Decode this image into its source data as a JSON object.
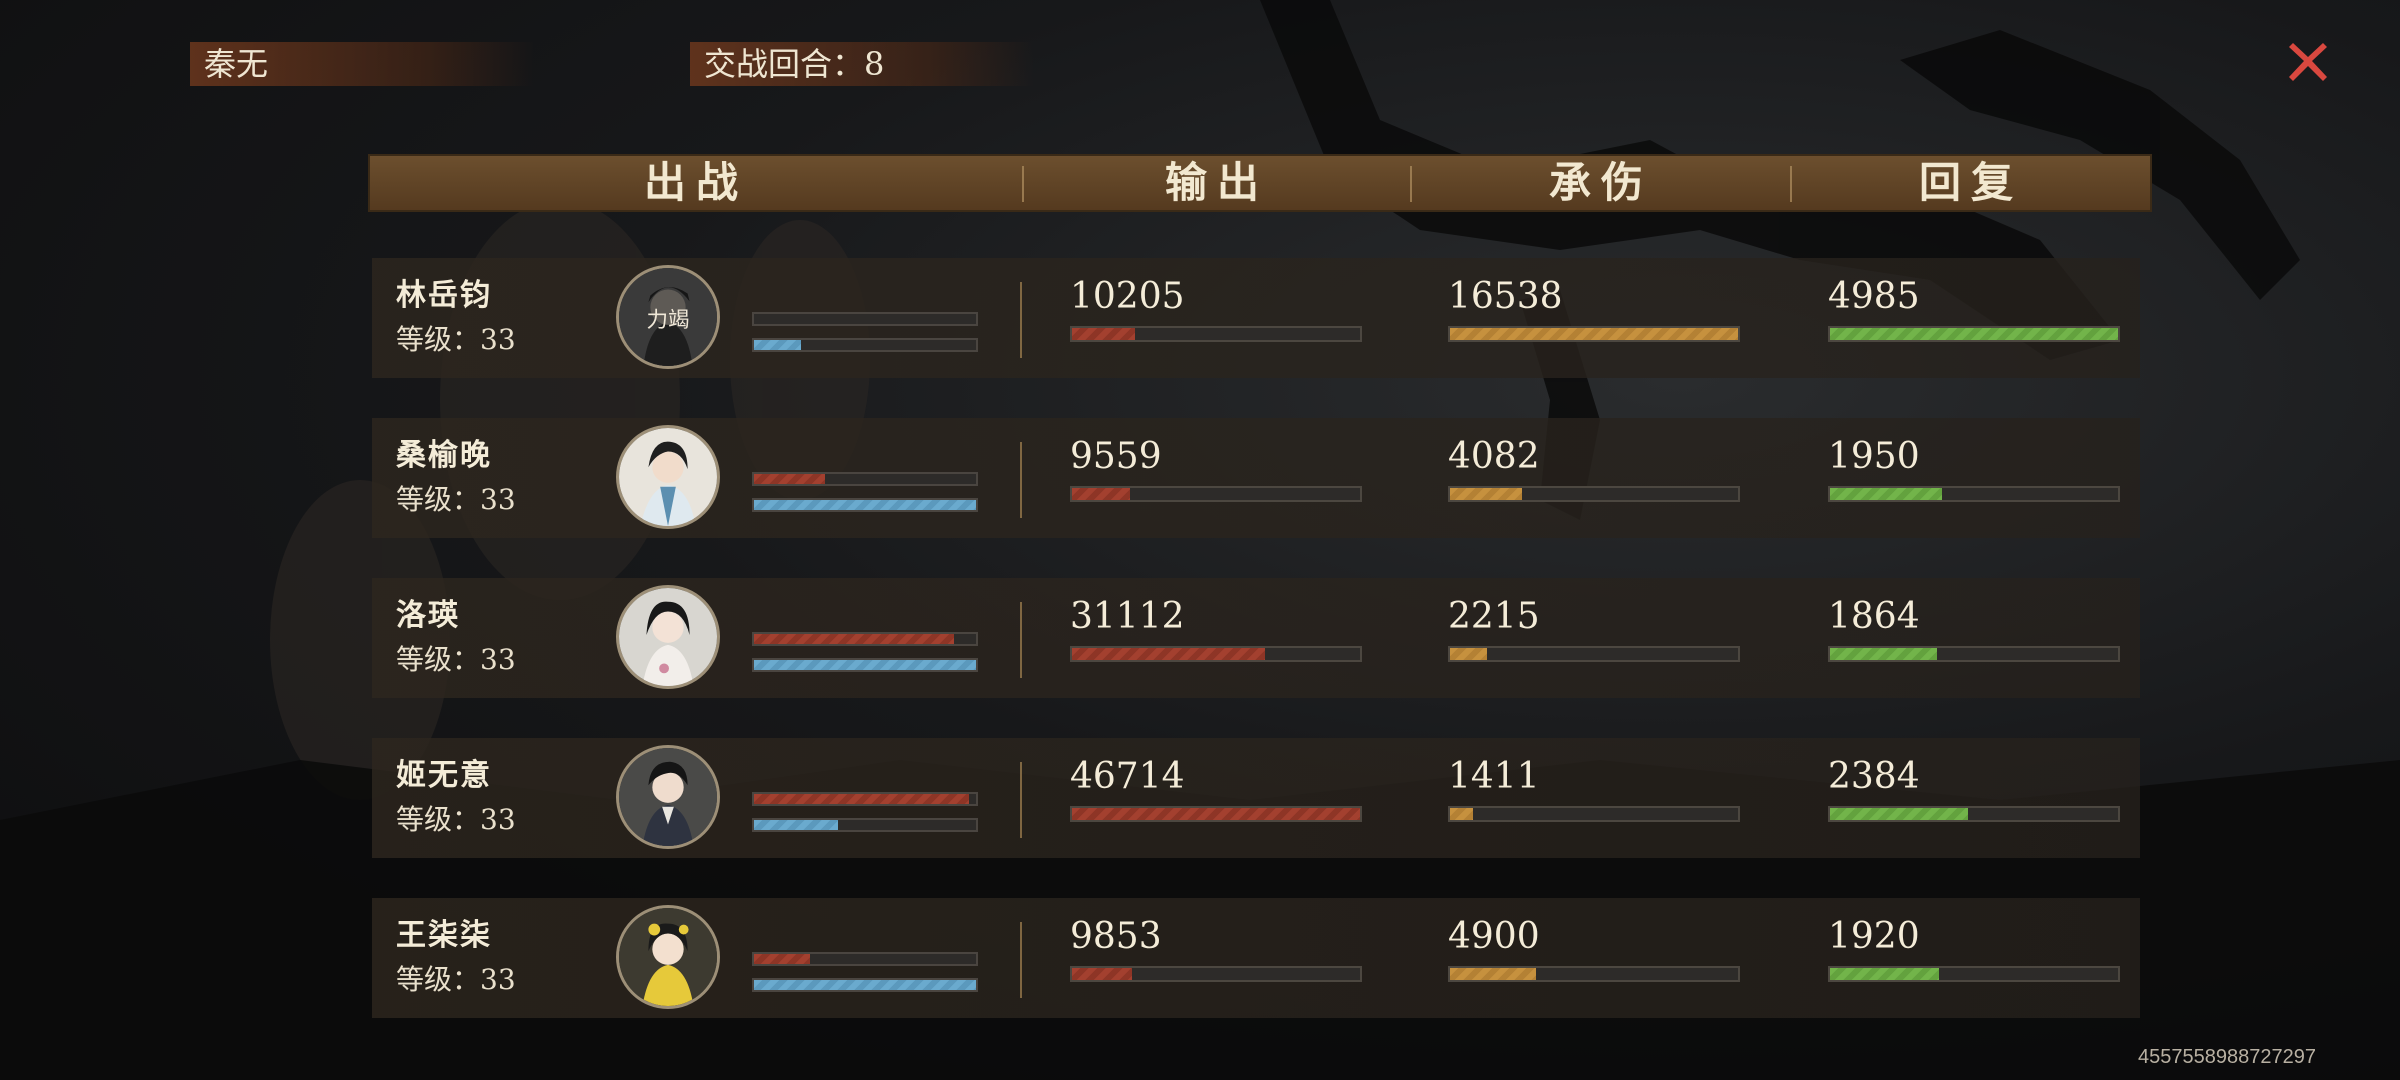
{
  "top_bar": {
    "player_name": "秦无",
    "round_label": "交战回合：8"
  },
  "header": {
    "col_deploy": "出战",
    "col_output": "输出",
    "col_damage_taken": "承伤",
    "col_heal": "回复"
  },
  "rows": [
    {
      "name": "林岳钧",
      "level": "等级：33",
      "portrait_badge": "力竭",
      "hp_fraction": 0.0,
      "mp_fraction": 0.21,
      "output": "10205",
      "output_fraction": 0.22,
      "damage_taken": "16538",
      "damage_fraction": 1.0,
      "heal": "4985",
      "heal_fraction": 1.0
    },
    {
      "name": "桑榆晚",
      "level": "等级：33",
      "hp_fraction": 0.32,
      "mp_fraction": 1.0,
      "output": "9559",
      "output_fraction": 0.2,
      "damage_taken": "4082",
      "damage_fraction": 0.25,
      "heal": "1950",
      "heal_fraction": 0.39
    },
    {
      "name": "洛瑛",
      "level": "等级：33",
      "hp_fraction": 0.9,
      "mp_fraction": 1.0,
      "output": "31112",
      "output_fraction": 0.67,
      "damage_taken": "2215",
      "damage_fraction": 0.13,
      "heal": "1864",
      "heal_fraction": 0.37
    },
    {
      "name": "姬无意",
      "level": "等级：33",
      "hp_fraction": 0.97,
      "mp_fraction": 0.38,
      "output": "46714",
      "output_fraction": 1.0,
      "damage_taken": "1411",
      "damage_fraction": 0.08,
      "heal": "2384",
      "heal_fraction": 0.48
    },
    {
      "name": "王柒柒",
      "level": "等级：33",
      "hp_fraction": 0.25,
      "mp_fraction": 1.0,
      "output": "9853",
      "output_fraction": 0.21,
      "damage_taken": "4900",
      "damage_fraction": 0.3,
      "heal": "1920",
      "heal_fraction": 0.38
    }
  ],
  "footer_id": "4557558988727297",
  "colors": {
    "output_bar": "#a3402f",
    "damage_bar": "#c6913e",
    "heal_bar": "#72b44a",
    "mp_bar": "#6aaace",
    "close_icon": "#d9483f"
  },
  "icons": {
    "close": "close-x-icon"
  }
}
